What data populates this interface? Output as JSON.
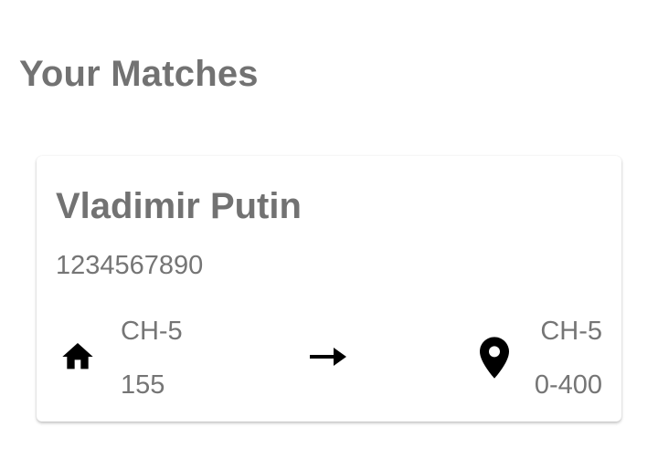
{
  "page": {
    "title": "Your Matches"
  },
  "matches": [
    {
      "name": "Vladimir Putin",
      "phone": "1234567890",
      "origin": {
        "icon": "home-icon",
        "line1": "CH-5",
        "line2": "155"
      },
      "direction_icon": "arrow-right-icon",
      "destination": {
        "icon": "location-pin-icon",
        "line1": "CH-5",
        "line2": "0-400"
      }
    }
  ],
  "colors": {
    "text_primary": "#727272",
    "text_secondary": "#757575",
    "icon": "#000000",
    "card_background": "#ffffff"
  }
}
